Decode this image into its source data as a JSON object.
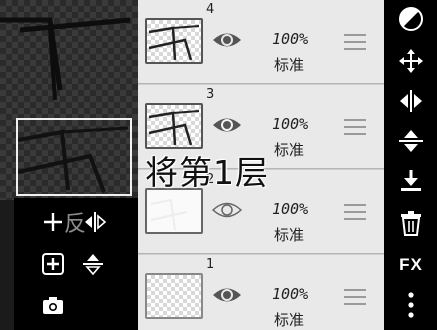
{
  "layers": [
    {
      "number": "4",
      "opacity": "100%",
      "blend": "标准",
      "visible": true,
      "thumb": "panels-4"
    },
    {
      "number": "3",
      "opacity": "100%",
      "blend": "标准",
      "visible": true,
      "thumb": "panels-3"
    },
    {
      "number": "2",
      "opacity": "100%",
      "blend": "标准",
      "visible": false,
      "thumb": "empty"
    },
    {
      "number": "1",
      "opacity": "100%",
      "blend": "标准",
      "visible": true,
      "thumb": "empty"
    }
  ],
  "overlay": {
    "caption": "将第1层",
    "left_caption": "反"
  },
  "right_toolbar": {
    "items": [
      "blend-mode-icon",
      "move-icon",
      "flip-horizontal-icon",
      "flip-vertical-icon",
      "merge-down-icon",
      "trash-icon",
      "FX",
      "more-vertical-icon"
    ],
    "fx_label": "FX"
  },
  "left_toolbar": {
    "items": [
      "add-layer-icon",
      "flip-horizontal-icon",
      "add-image-layer-icon",
      "flip-vertical-icon",
      "camera-icon"
    ]
  }
}
